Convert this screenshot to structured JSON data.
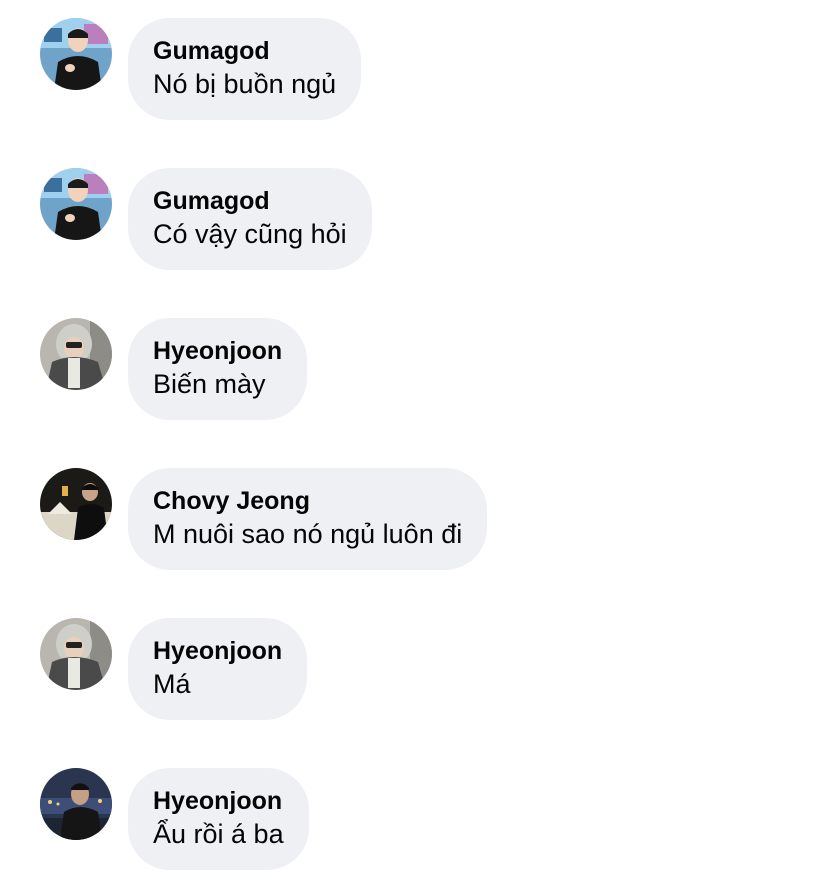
{
  "comments": [
    {
      "author": "Gumagod",
      "text": "Nó bị buồn ngủ",
      "avatar_icon": "profile-photo-man-neon-background"
    },
    {
      "author": "Gumagod",
      "text": "Có vậy cũng hỏi",
      "avatar_icon": "profile-photo-man-neon-background"
    },
    {
      "author": "Hyeonjoon",
      "text": "Biến mày",
      "avatar_icon": "profile-photo-hooded-person"
    },
    {
      "author": "Chovy Jeong",
      "text": "M nuôi sao nó ngủ luôn đi",
      "avatar_icon": "profile-photo-man-dark-outdoor"
    },
    {
      "author": "Hyeonjoon",
      "text": "Má",
      "avatar_icon": "profile-photo-hooded-person"
    },
    {
      "author": "Hyeonjoon",
      "text": "Ẩu rồi á ba",
      "avatar_icon": "profile-photo-man-city-night"
    }
  ],
  "colors": {
    "bubble_background": "#eff0f4",
    "text": "#050505",
    "page_background": "#ffffff"
  }
}
